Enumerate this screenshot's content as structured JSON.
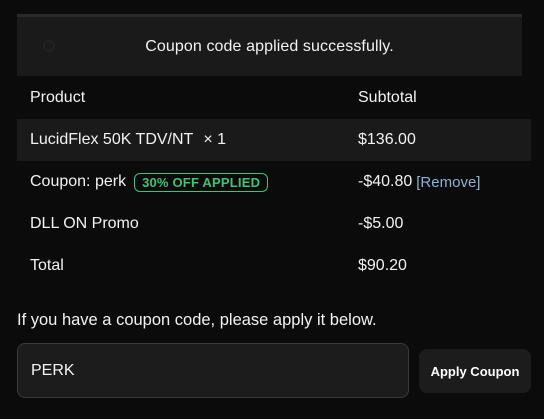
{
  "notice": {
    "message": "Coupon code applied successfully.",
    "icon": "info-circle-icon"
  },
  "cart": {
    "headers": {
      "product": "Product",
      "subtotal": "Subtotal"
    },
    "item": {
      "name": "LucidFlex 50K TDV/NT",
      "quantity": "× 1",
      "subtotal": "$136.00"
    },
    "coupon": {
      "label": "Coupon: perk",
      "badge": "30% OFF APPLIED",
      "amount": "-$40.80",
      "remove_label": "[Remove]"
    },
    "promo": {
      "label": "DLL ON Promo",
      "amount": "-$5.00"
    },
    "total": {
      "label": "Total",
      "amount": "$90.20"
    }
  },
  "coupon_form": {
    "hint": "If you have a coupon code, please apply it below.",
    "input_value": "PERK",
    "apply_label": "Apply Coupon"
  },
  "colors": {
    "background": "#0b0b0b",
    "panel": "#1a1a1a",
    "badge_green": "#3ec27a",
    "link_blue": "#8fb0d8"
  }
}
